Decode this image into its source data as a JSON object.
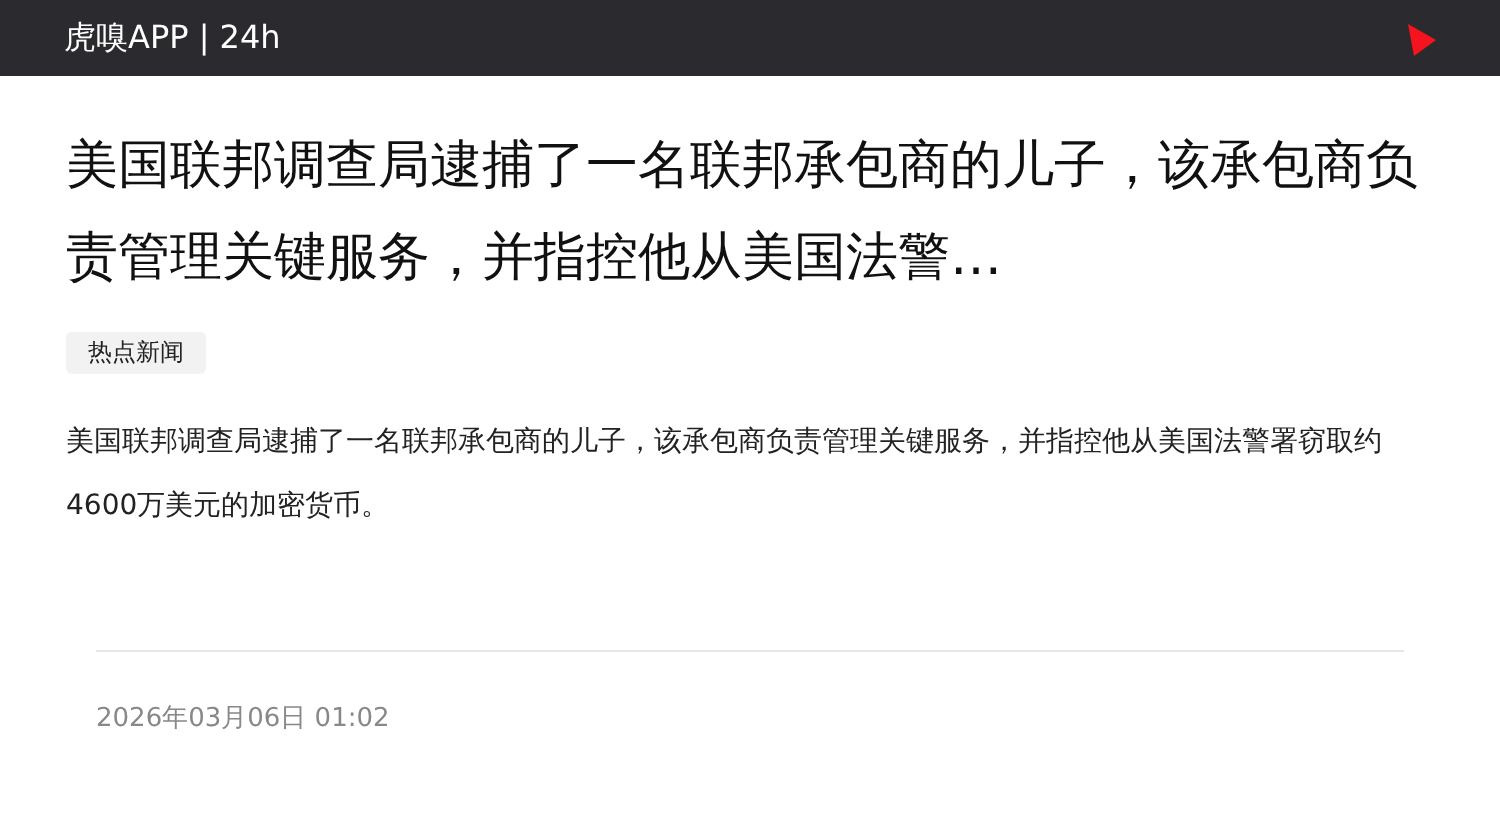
{
  "header": {
    "title": "虎嗅APP | 24h"
  },
  "article": {
    "title": "美国联邦调查局逮捕了一名联邦承包商的儿子，该承包商负责管理关键服务，并指控他从美国法警…",
    "tag": "热点新闻",
    "summary": "美国联邦调查局逮捕了一名联邦承包商的儿子，该承包商负责管理关键服务，并指控他从美国法警署窃取约4600万美元的加密货币。",
    "date": "2026年03月06日 01:02"
  }
}
